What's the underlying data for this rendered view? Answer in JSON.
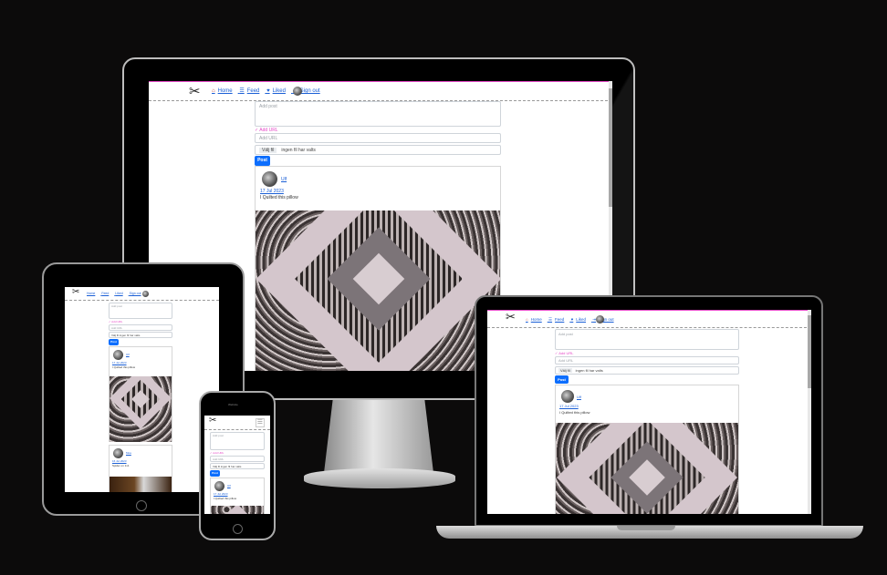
{
  "app": {
    "nav": {
      "home": "Home",
      "feed": "Feed",
      "liked": "Liked",
      "sign_out": "Sign out"
    },
    "form": {
      "post_placeholder": "Add post",
      "url_hint": "✓ Add URL",
      "url_placeholder": "Add URL",
      "file_button": "Välj fil",
      "file_status": "ingen fil har valts",
      "post_button": "Post"
    },
    "posts": [
      {
        "user": "Ulf",
        "date": "17 Jul 2023",
        "caption": "I Quilted this pillow"
      },
      {
        "user": "Moa",
        "date": "16 Jul 2023",
        "caption": "Spider on 1x1"
      }
    ],
    "phone_status": "Website"
  },
  "icons": [
    "scissors-logo-icon",
    "home-icon",
    "feed-icon",
    "heart-icon",
    "sign-out-icon",
    "hamburger-icon"
  ],
  "colors": {
    "background": "#0c0b0b",
    "link": "#1a5fd6",
    "button": "#0d6efd",
    "url_hint": "#e64ac8"
  }
}
